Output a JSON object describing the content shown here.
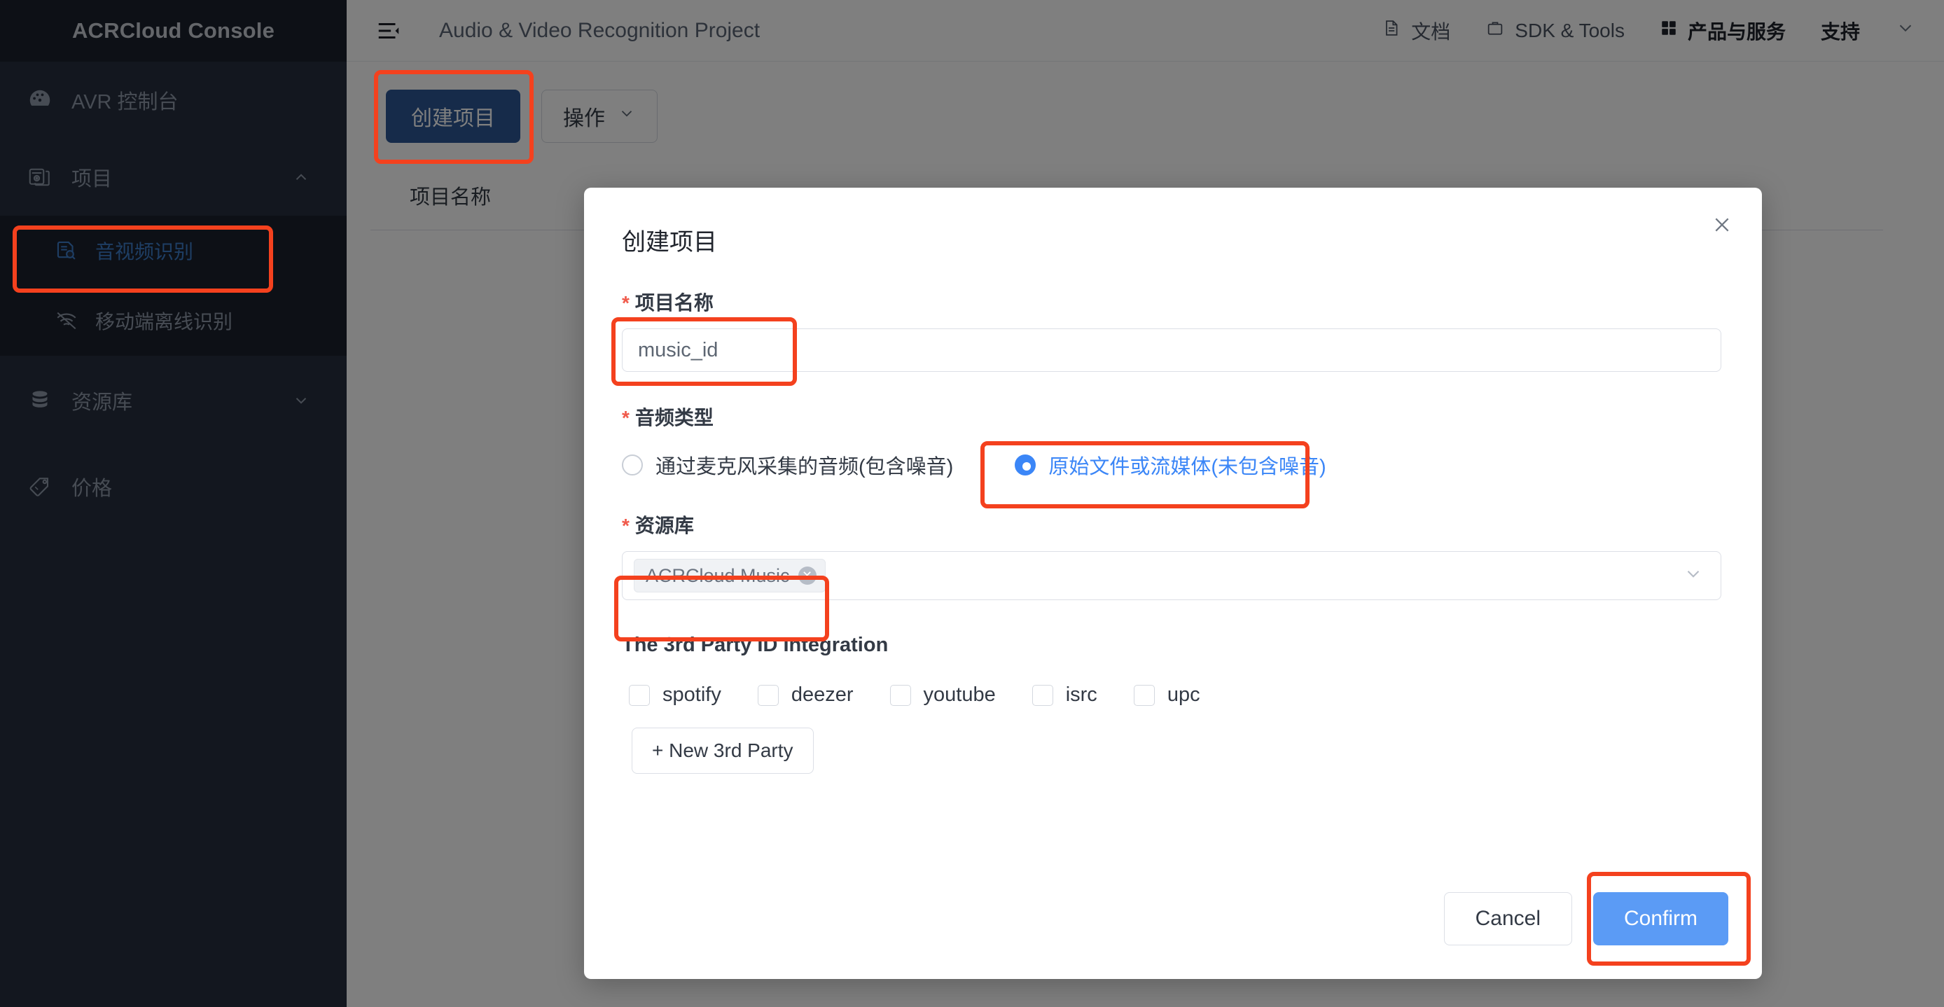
{
  "sidebar": {
    "brand": "ACRCloud Console",
    "items": [
      {
        "label": "AVR 控制台",
        "icon": "dashboard-icon",
        "has_chevron": false
      },
      {
        "label": "项目",
        "icon": "project-icon",
        "has_chevron": true,
        "chevron": "chevron-up-icon"
      },
      {
        "label": "资源库",
        "icon": "database-icon",
        "has_chevron": true,
        "chevron": "chevron-down-icon"
      },
      {
        "label": "价格",
        "icon": "price-tag-icon",
        "has_chevron": false
      }
    ],
    "sub_items": [
      {
        "label": "音视频识别",
        "icon": "audio-video-recognition-icon",
        "active": true
      },
      {
        "label": "移动端离线识别",
        "icon": "offline-recognition-icon",
        "active": false
      }
    ]
  },
  "header": {
    "menu_icon": "collapse-sidebar-icon",
    "page_title": "Audio & Video Recognition Project",
    "nav": [
      {
        "label": "文档",
        "icon": "document-icon",
        "bold": false
      },
      {
        "label": "SDK & Tools",
        "icon": "toolbox-icon",
        "bold": false
      },
      {
        "label": "产品与服务",
        "icon": "grid-apps-icon",
        "bold": true
      },
      {
        "label": "支持",
        "icon": "",
        "bold": false
      },
      {
        "label": "",
        "icon": "chevron-down-icon",
        "bold": false
      }
    ]
  },
  "toolbar": {
    "create_project_label": "创建项目",
    "actions_label": "操作",
    "actions_icon": "chevron-down-icon"
  },
  "table": {
    "columns": [
      "项目名称"
    ]
  },
  "modal": {
    "title": "创建项目",
    "close_icon": "close-icon",
    "project_name": {
      "label": "项目名称",
      "required_mark": "*",
      "value": "music_id",
      "placeholder": "music_id"
    },
    "audio_type": {
      "label": "音频类型",
      "required_mark": "*",
      "options": [
        {
          "label": "通过麦克风采集的音频(包含噪音)",
          "checked": false
        },
        {
          "label": "原始文件或流媒体(未包含噪音)",
          "checked": true
        }
      ]
    },
    "resource_library": {
      "label": "资源库",
      "required_mark": "*",
      "tags": [
        {
          "label": "ACRCloud Music",
          "remove_icon": "tag-remove-icon"
        }
      ],
      "dropdown_icon": "chevron-down-icon"
    },
    "third_party": {
      "title": "The 3rd Party ID Integration",
      "checkboxes": [
        {
          "label": "spotify",
          "checked": false
        },
        {
          "label": "deezer",
          "checked": false
        },
        {
          "label": "youtube",
          "checked": false
        },
        {
          "label": "isrc",
          "checked": false
        },
        {
          "label": "upc",
          "checked": false
        }
      ],
      "new_button_label": "+ New 3rd Party"
    },
    "footer": {
      "cancel_label": "Cancel",
      "confirm_label": "Confirm"
    }
  },
  "colors": {
    "sidebar_bg": "#262f3e",
    "sidebar_brand_bg": "#1b212c",
    "accent_blue": "#3b86f7",
    "confirm_blue": "#5b9bf5",
    "create_button_blue": "#2c5694",
    "required_red": "#f05a4b",
    "highlight_red": "#f4411e",
    "active_nav_blue": "#3c7cc9"
  },
  "annotations": {
    "highlight_boxes": [
      "sidebar-audio-video-recognition",
      "create-project-button",
      "project-name-input",
      "audio-type-original-file-radio",
      "resource-library-tag",
      "confirm-button"
    ]
  }
}
